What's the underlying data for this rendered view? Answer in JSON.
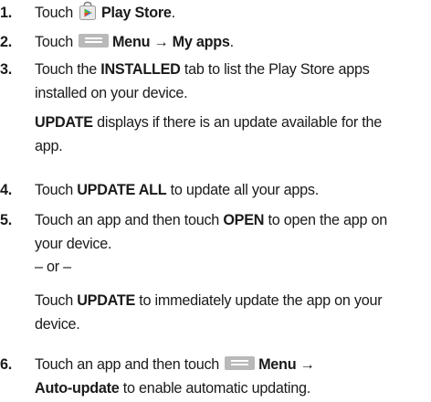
{
  "steps": [
    {
      "num": "1.",
      "before": "Touch",
      "icon": "play-store-icon",
      "bold": "Play Store",
      "after": "."
    },
    {
      "num": "2.",
      "before": "Touch",
      "icon": "menu-icon",
      "bold": "Menu → My apps",
      "after": "."
    },
    {
      "num": "3.",
      "line1_before": "Touch the ",
      "line1_bold": "INSTALLED",
      "line1_after": " tab to list the Play Store apps installed on your device.",
      "para_bold": "UPDATE",
      "para_after": " displays if there is an update available for the app."
    },
    {
      "num": "4.",
      "before": "Touch ",
      "bold": "UPDATE ALL",
      "after": " to update all your apps."
    },
    {
      "num": "5.",
      "before": "Touch an app and then touch ",
      "bold": "OPEN",
      "after": " to open the app on your device.",
      "or_text": "– or –",
      "para_before": "Touch ",
      "para_bold": "UPDATE",
      "para_after": " to immediately update the app on your device."
    },
    {
      "num": "6.",
      "before": "Touch an app and then touch",
      "icon": "menu-icon",
      "bold": "Menu →",
      "bold2": "Auto-update",
      "after": " to enable automatic updating."
    }
  ],
  "colors": {
    "menu_icon": "#b9b9b9",
    "store_green": "#5fb830",
    "store_blue": "#1e88d8",
    "store_red": "#e8452f",
    "store_yellow": "#f6c11d"
  }
}
